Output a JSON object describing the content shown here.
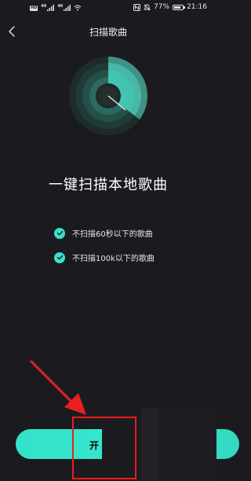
{
  "status_bar": {
    "left_badges": [
      "HD",
      "46",
      "46",
      "1"
    ],
    "battery_level": 0.77,
    "battery_text": "77%",
    "time": "21:16",
    "icons": [
      "wifi-icon",
      "nfc-icon",
      "mute-icon",
      "battery-icon"
    ]
  },
  "nav": {
    "back_icon": "back-chevron-icon",
    "title": "扫描歌曲"
  },
  "scan": {
    "headline": "一键扫描本地歌曲",
    "conditions": [
      {
        "text": "不扫描60秒以下的歌曲",
        "icon": "check-circle-icon"
      },
      {
        "text": "不扫描100k以下的歌曲",
        "icon": "check-circle-icon"
      }
    ],
    "start_button_label": "开"
  },
  "colors": {
    "background": "#1b1b1f",
    "accent": "#3ce0cc",
    "annotation": "#e8201e"
  }
}
